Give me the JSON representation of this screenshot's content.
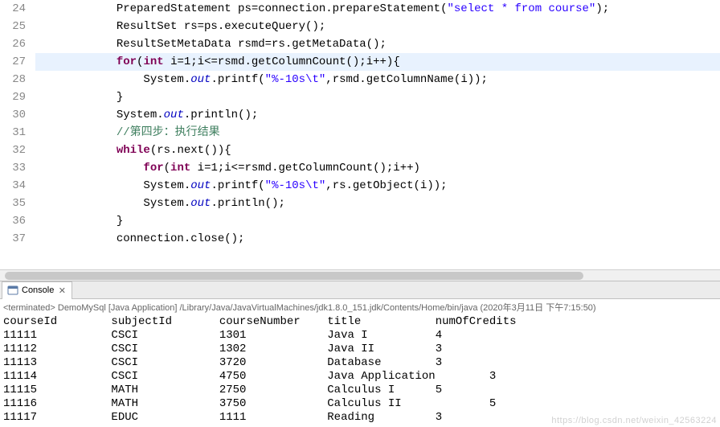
{
  "editor": {
    "first_line_no": 24,
    "lines": [
      {
        "n": 24,
        "segs": [
          {
            "t": "            PreparedStatement ps=connection.prepareStatement("
          },
          {
            "t": "\"select * from course\"",
            "c": "str"
          },
          {
            "t": ");"
          }
        ]
      },
      {
        "n": 25,
        "segs": [
          {
            "t": "            ResultSet rs=ps.executeQuery();"
          }
        ]
      },
      {
        "n": 26,
        "segs": [
          {
            "t": "            ResultSetMetaData rsmd=rs.getMetaData();"
          }
        ]
      },
      {
        "n": 27,
        "hl": true,
        "segs": [
          {
            "t": "            "
          },
          {
            "t": "for",
            "c": "kw"
          },
          {
            "t": "("
          },
          {
            "t": "int",
            "c": "kw"
          },
          {
            "t": " i=1;i<=rsmd.getColumnCount();i++){"
          }
        ]
      },
      {
        "n": 28,
        "segs": [
          {
            "t": "                System."
          },
          {
            "t": "out",
            "c": "field"
          },
          {
            "t": ".printf("
          },
          {
            "t": "\"%-10s\\t\"",
            "c": "str"
          },
          {
            "t": ",rsmd.getColumnName(i));"
          }
        ]
      },
      {
        "n": 29,
        "segs": [
          {
            "t": "            }"
          }
        ]
      },
      {
        "n": 30,
        "segs": [
          {
            "t": "            System."
          },
          {
            "t": "out",
            "c": "field"
          },
          {
            "t": ".println();"
          }
        ]
      },
      {
        "n": 31,
        "segs": [
          {
            "t": "            "
          },
          {
            "t": "//第四步：执行结果",
            "c": "cmt"
          }
        ]
      },
      {
        "n": 32,
        "segs": [
          {
            "t": "            "
          },
          {
            "t": "while",
            "c": "kw"
          },
          {
            "t": "(rs.next()){"
          }
        ]
      },
      {
        "n": 33,
        "segs": [
          {
            "t": "                "
          },
          {
            "t": "for",
            "c": "kw"
          },
          {
            "t": "("
          },
          {
            "t": "int",
            "c": "kw"
          },
          {
            "t": " i=1;i<=rsmd.getColumnCount();i++)"
          }
        ]
      },
      {
        "n": 34,
        "segs": [
          {
            "t": "                System."
          },
          {
            "t": "out",
            "c": "field"
          },
          {
            "t": ".printf("
          },
          {
            "t": "\"%-10s\\t\"",
            "c": "str"
          },
          {
            "t": ",rs.getObject(i));"
          }
        ]
      },
      {
        "n": 35,
        "segs": [
          {
            "t": "                System."
          },
          {
            "t": "out",
            "c": "field"
          },
          {
            "t": ".println();"
          }
        ]
      },
      {
        "n": 36,
        "segs": [
          {
            "t": "            }"
          }
        ]
      },
      {
        "n": 37,
        "segs": [
          {
            "t": "            connection.close();"
          }
        ]
      }
    ]
  },
  "console": {
    "tab_label": "Console",
    "term_line": "<terminated> DemoMySql [Java Application] /Library/Java/JavaVirtualMachines/jdk1.8.0_151.jdk/Contents/Home/bin/java (2020年3月11日 下午7:15:50)",
    "headers": [
      "courseId",
      "subjectId",
      "courseNumber",
      "title",
      "numOfCredits"
    ],
    "rows": [
      [
        "11111",
        "CSCI",
        "1301",
        "Java I",
        "4"
      ],
      [
        "11112",
        "CSCI",
        "1302",
        "Java II",
        "3"
      ],
      [
        "11113",
        "CSCI",
        "3720",
        "Database",
        "3"
      ],
      [
        "11114",
        "CSCI",
        "4750",
        "Java Application",
        "3"
      ],
      [
        "11115",
        "MATH",
        "2750",
        "Calculus I",
        "5"
      ],
      [
        "11116",
        "MATH",
        "3750",
        "Calculus II",
        "5"
      ],
      [
        "11117",
        "EDUC",
        "1111",
        "Reading",
        "3"
      ]
    ]
  },
  "watermark": "https://blog.csdn.net/weixin_42563224"
}
